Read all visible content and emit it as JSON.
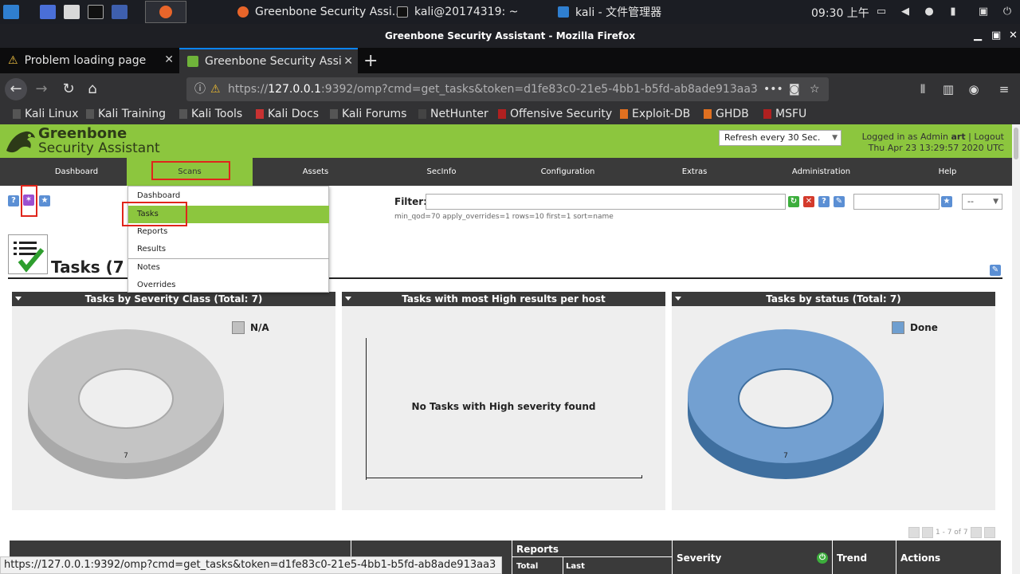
{
  "taskbar": {
    "windows": [
      {
        "label": "Greenbone Security Assi..."
      },
      {
        "label": "kali@20174319: ~"
      },
      {
        "label": "kali - 文件管理器"
      }
    ],
    "clock": "09:30 上午"
  },
  "window": {
    "title": "Greenbone Security Assistant - Mozilla Firefox"
  },
  "tabs": [
    {
      "label": "Problem loading page"
    },
    {
      "label": "Greenbone Security Assi"
    }
  ],
  "urlbar": {
    "prefix": "https://",
    "host": "127.0.0.1",
    "rest": ":9392/omp?cmd=get_tasks&token=d1fe83c0-21e5-4bb1-b5fd-ab8ade913aa3"
  },
  "bookmarks": [
    {
      "label": "Kali Linux"
    },
    {
      "label": "Kali Training"
    },
    {
      "label": "Kali Tools"
    },
    {
      "label": "Kali Docs"
    },
    {
      "label": "Kali Forums"
    },
    {
      "label": "NetHunter"
    },
    {
      "label": "Offensive Security"
    },
    {
      "label": "Exploit-DB"
    },
    {
      "label": "GHDB"
    },
    {
      "label": "MSFU"
    }
  ],
  "gsa": {
    "logo_line1": "Greenbone",
    "logo_line2": "Security Assistant",
    "refresh": "Refresh every 30 Sec.",
    "logged_in_prefix": "Logged in as",
    "role": "Admin",
    "user": "art",
    "separator": "|",
    "logout": "Logout",
    "datetime": "Thu Apr 23 13:29:57 2020 UTC"
  },
  "mainnav": [
    "Dashboard",
    "Scans",
    "Assets",
    "SecInfo",
    "Configuration",
    "Extras",
    "Administration",
    "Help"
  ],
  "dropdown": [
    "Dashboard",
    "Tasks",
    "Reports",
    "Results",
    "Notes",
    "Overrides"
  ],
  "filter": {
    "label": "Filter:",
    "value": "",
    "params": "min_qod=70 apply_overrides=1 rows=10 first=1 sort=name",
    "select": "--"
  },
  "page_title": "Tasks (7 o",
  "panels": [
    {
      "title": "Tasks by Severity Class (Total: 7)",
      "legend": "N/A",
      "label": "7"
    },
    {
      "title": "Tasks with most High results per host",
      "message": "No Tasks with High severity found"
    },
    {
      "title": "Tasks by status (Total: 7)",
      "legend": "Done",
      "label": "7"
    }
  ],
  "chart_data": [
    {
      "type": "pie",
      "title": "Tasks by Severity Class (Total: 7)",
      "categories": [
        "N/A"
      ],
      "values": [
        7
      ]
    },
    {
      "type": "bar",
      "title": "Tasks with most High results per host",
      "categories": [],
      "values": []
    },
    {
      "type": "pie",
      "title": "Tasks by status (Total: 7)",
      "categories": [
        "Done"
      ],
      "values": [
        7
      ]
    }
  ],
  "colors": {
    "gsa_green": "#8cc63e",
    "nav_dark": "#3a3a3a",
    "na_gray": "#c0c0c0",
    "done_blue": "#6f9fd0",
    "highlight": "#e0251b"
  },
  "pager": "1 - 7 of 7",
  "table": {
    "reports": "Reports",
    "total": "Total",
    "last": "Last",
    "severity": "Severity",
    "trend": "Trend",
    "actions": "Actions"
  },
  "statusbar": "https://127.0.0.1:9392/omp?cmd=get_tasks&token=d1fe83c0-21e5-4bb1-b5fd-ab8ade913aa3"
}
